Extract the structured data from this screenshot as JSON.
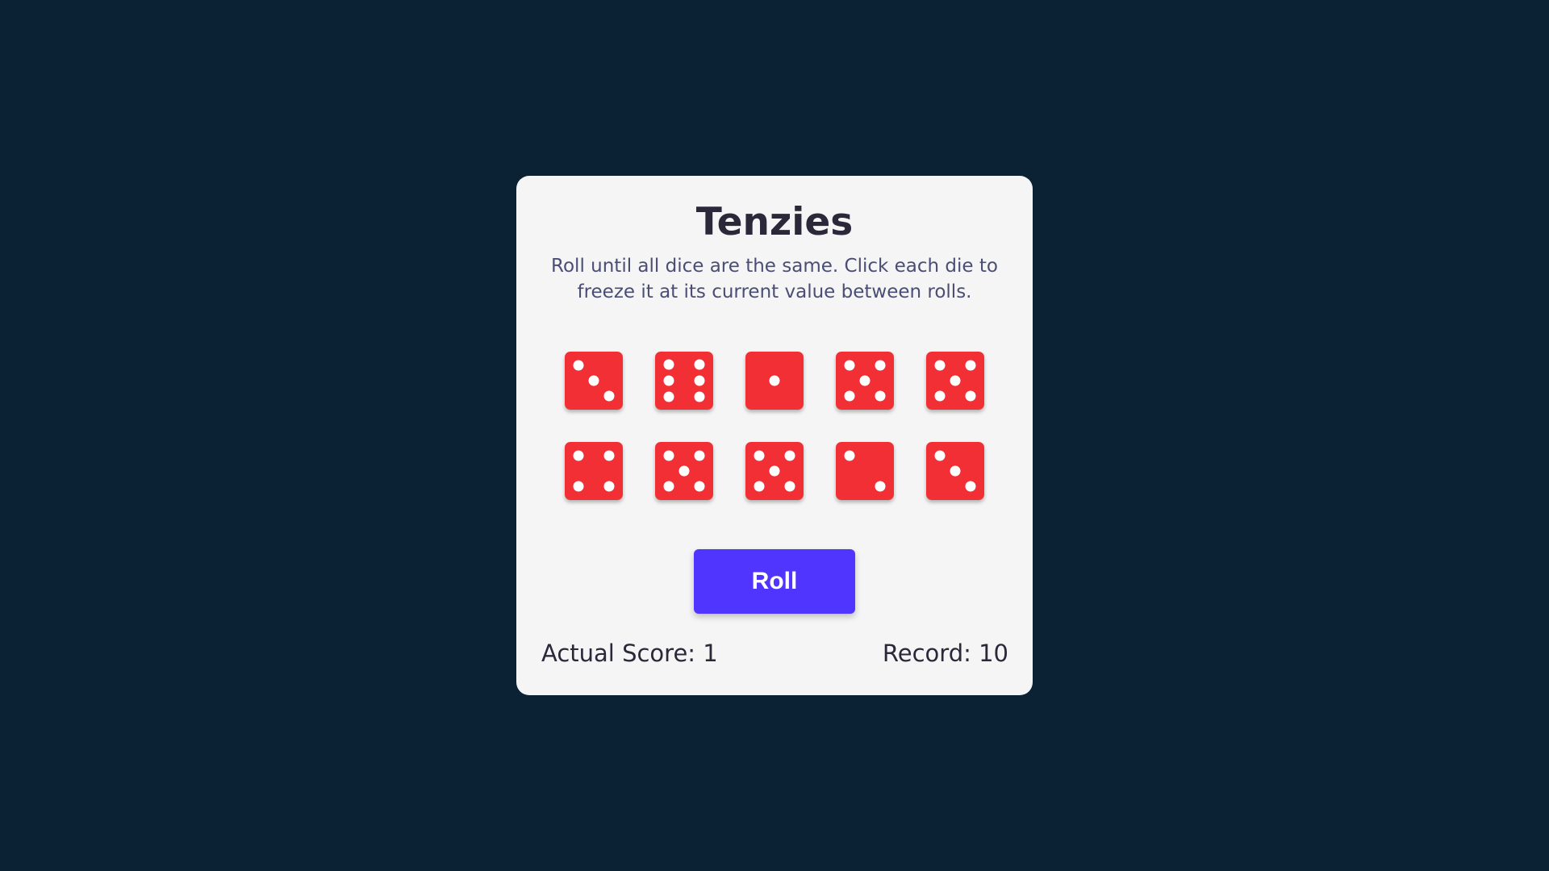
{
  "app": {
    "title": "Tenzies",
    "instructions": "Roll until all dice are the same. Click each die to freeze it at its current value between rolls."
  },
  "dice": [
    3,
    6,
    1,
    5,
    5,
    4,
    5,
    5,
    2,
    3
  ],
  "colors": {
    "background": "#0b2234",
    "board": "#f5f5f5",
    "die": "#f12f35",
    "pip": "#ffffff",
    "button": "#5035ff"
  },
  "controls": {
    "roll_label": "Roll"
  },
  "scores": {
    "actual": "Actual Score: 1",
    "record": "Record: 10"
  }
}
